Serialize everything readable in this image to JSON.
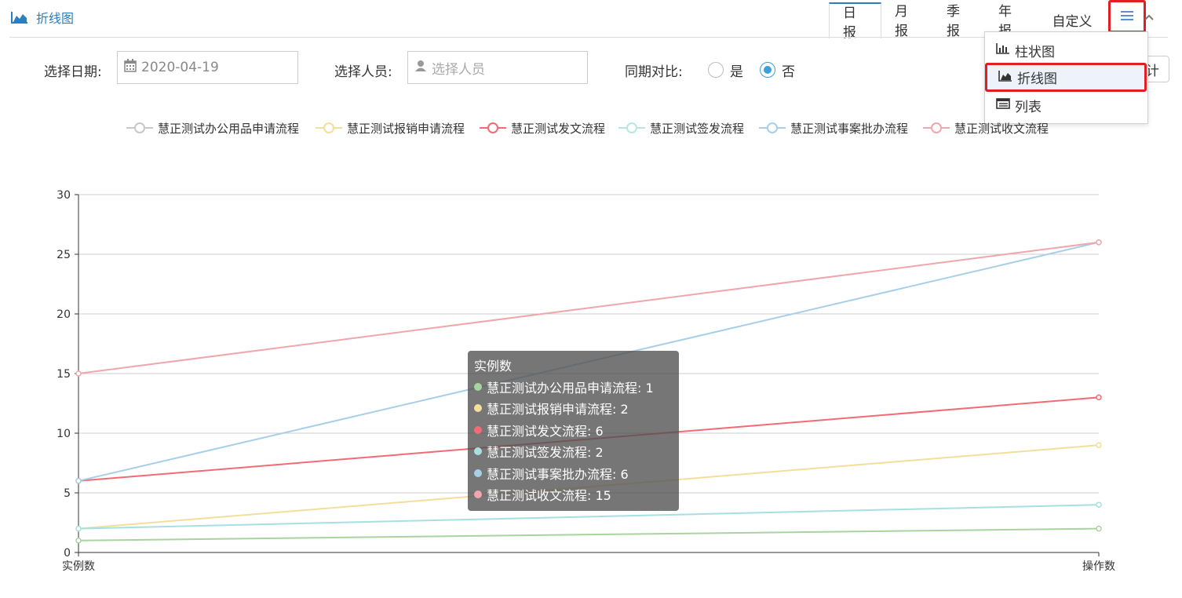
{
  "header": {
    "title": "折线图",
    "chart_icon": "area-chart-icon"
  },
  "tabs": [
    {
      "label": "日报",
      "active": true
    },
    {
      "label": "月报",
      "active": false
    },
    {
      "label": "季报",
      "active": false
    },
    {
      "label": "年报",
      "active": false
    },
    {
      "label": "自定义",
      "active": false
    }
  ],
  "menu": {
    "toggle_icon": "hamburger-icon",
    "collapse_icon": "chevron-up-icon",
    "items": [
      {
        "label": "柱状图",
        "icon": "bar-chart-icon",
        "selected": false
      },
      {
        "label": "折线图",
        "icon": "area-chart-icon",
        "selected": true
      },
      {
        "label": "列表",
        "icon": "list-icon",
        "selected": false
      }
    ]
  },
  "side_button": {
    "label": "计"
  },
  "filters": {
    "date_label": "选择日期:",
    "date_value": "2020-04-19",
    "person_label": "选择人员:",
    "person_placeholder": "选择人员",
    "compare_label": "同期对比:",
    "compare_yes": "是",
    "compare_no": "否",
    "compare_selected": "否"
  },
  "chart_data": {
    "type": "line",
    "categories": [
      "实例数",
      "操作数"
    ],
    "ylim": [
      0,
      30
    ],
    "yticks": [
      0,
      5,
      10,
      15,
      20,
      25,
      30
    ],
    "grid": true,
    "legend_position": "top",
    "series": [
      {
        "name": "慧正测试办公用品申请流程",
        "values": [
          1,
          2
        ],
        "color": "#a9d4a0",
        "legend_color": "#c8c8c8"
      },
      {
        "name": "慧正测试报销申请流程",
        "values": [
          2,
          9
        ],
        "color": "#f3df9b",
        "legend_color": "#f3df9b"
      },
      {
        "name": "慧正测试发文流程",
        "values": [
          6,
          13
        ],
        "color": "#f36a74",
        "legend_color": "#f36a74"
      },
      {
        "name": "慧正测试签发流程",
        "values": [
          2,
          4
        ],
        "color": "#a8e0e0",
        "legend_color": "#b7e6e0"
      },
      {
        "name": "慧正测试事案批办流程",
        "values": [
          6,
          26
        ],
        "color": "#a7cfe8",
        "legend_color": "#a7cfe8"
      },
      {
        "name": "慧正测试收文流程",
        "values": [
          15,
          26
        ],
        "color": "#f0a6ad",
        "legend_color": "#f0a6ad"
      }
    ]
  },
  "tooltip": {
    "title": "实例数",
    "rows": [
      {
        "text": "慧正测试办公用品申请流程: 1",
        "color": "#a9d4a0"
      },
      {
        "text": "慧正测试报销申请流程: 2",
        "color": "#f3df9b"
      },
      {
        "text": "慧正测试发文流程: 6",
        "color": "#f36a74"
      },
      {
        "text": "慧正测试签发流程: 2",
        "color": "#a8e0e0"
      },
      {
        "text": "慧正测试事案批办流程: 6",
        "color": "#a7cfe8"
      },
      {
        "text": "慧正测试收文流程: 15",
        "color": "#f0a6ad"
      }
    ]
  }
}
